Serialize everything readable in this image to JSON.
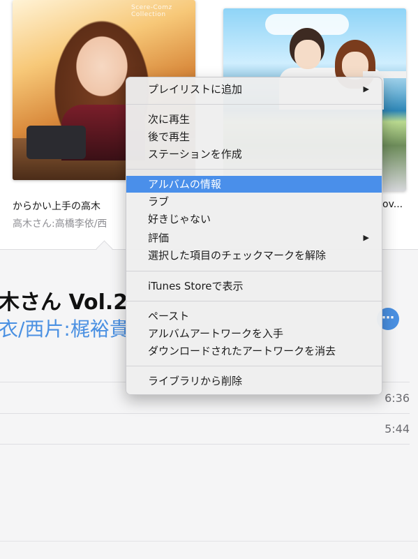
{
  "albums": [
    {
      "cover_label": "Scere-Comz Collection",
      "title": "からかい上手の高木",
      "artist": "高木さん:高橋李依/西"
    },
    {
      "title": "ov..."
    }
  ],
  "detail": {
    "title": "木さん Vol.2",
    "artist": "衣/西片:梶裕貴",
    "more_icon": "ellipsis-icon",
    "tracks": [
      {
        "duration": "6:36"
      },
      {
        "duration": "5:44"
      }
    ]
  },
  "menu": {
    "groups": [
      [
        {
          "label": "プレイリストに追加",
          "submenu": true
        }
      ],
      [
        {
          "label": "次に再生"
        },
        {
          "label": "後で再生"
        },
        {
          "label": "ステーションを作成"
        }
      ],
      [
        {
          "label": "アルバムの情報",
          "highlighted": true
        },
        {
          "label": "ラブ"
        },
        {
          "label": "好きじゃない"
        },
        {
          "label": "評価",
          "submenu": true
        },
        {
          "label": "選択した項目のチェックマークを解除"
        }
      ],
      [
        {
          "label": "iTunes Storeで表示"
        }
      ],
      [
        {
          "label": "ペースト"
        },
        {
          "label": "アルバムアートワークを入手"
        },
        {
          "label": "ダウンロードされたアートワークを消去"
        }
      ],
      [
        {
          "label": "ライブラリから削除"
        }
      ]
    ],
    "submenu_glyph": "▶",
    "highlight_color": "#4a8fea"
  },
  "colors": {
    "link_blue": "#4a90e2",
    "secondary_text": "#8e8e93"
  }
}
